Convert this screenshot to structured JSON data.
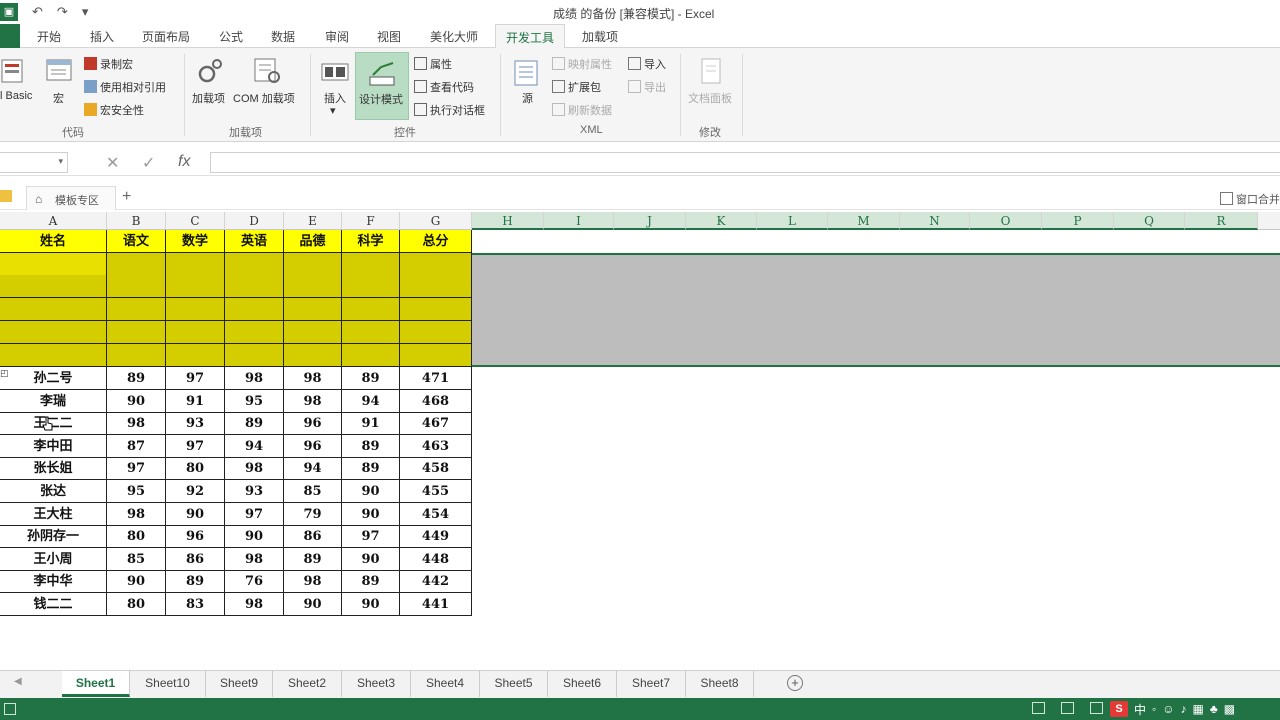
{
  "title": "成绩 的备份  [兼容模式] - Excel",
  "tabs": [
    "开始",
    "插入",
    "页面布局",
    "公式",
    "数据",
    "审阅",
    "视图",
    "美化大师",
    "开发工具",
    "加载项"
  ],
  "active_tab": "开发工具",
  "ribbon": {
    "code": {
      "vb": "l Basic",
      "macro": "宏",
      "record_macro": "录制宏",
      "relative_ref": "使用相对引用",
      "macro_security": "宏安全性",
      "label": "代码"
    },
    "addins": {
      "addins": "加载项",
      "com_addins": "COM 加载项",
      "label": "加载项"
    },
    "controls": {
      "insert": "插入",
      "design_mode": "设计模式",
      "properties": "属性",
      "view_code": "查看代码",
      "run_dialog": "执行对话框",
      "label": "控件"
    },
    "xml": {
      "source": "源",
      "map_props": "映射属性",
      "expansion": "扩展包",
      "refresh": "刷新数据",
      "import": "导入",
      "export": "导出",
      "label": "XML"
    },
    "modify": {
      "doc_panel": "文档面板",
      "label": "修改"
    }
  },
  "formula_bar": {
    "fx": "fx",
    "cancel": "✕",
    "confirm": "✓",
    "dropdown": "▾"
  },
  "doc_tab": {
    "label": "模板专区",
    "plus": "+",
    "window_merge": "窗口合并"
  },
  "columns": [
    "A",
    "B",
    "C",
    "D",
    "E",
    "F",
    "G",
    "H",
    "I",
    "J",
    "K",
    "L",
    "M",
    "N",
    "O",
    "P",
    "Q",
    "R"
  ],
  "header_row": [
    "姓名",
    "语文",
    "数学",
    "英语",
    "品德",
    "科学",
    "总分"
  ],
  "rows": [
    [
      "孙二号",
      "89",
      "97",
      "98",
      "98",
      "89",
      "471"
    ],
    [
      "李瑞",
      "90",
      "91",
      "95",
      "98",
      "94",
      "468"
    ],
    [
      "王二二",
      "98",
      "93",
      "89",
      "96",
      "91",
      "467"
    ],
    [
      "李中田",
      "87",
      "97",
      "94",
      "96",
      "89",
      "463"
    ],
    [
      "张长姐",
      "97",
      "80",
      "98",
      "94",
      "89",
      "458"
    ],
    [
      "张达",
      "95",
      "92",
      "93",
      "85",
      "90",
      "455"
    ],
    [
      "王大柱",
      "98",
      "90",
      "97",
      "79",
      "90",
      "454"
    ],
    [
      "孙阴存一",
      "80",
      "96",
      "90",
      "86",
      "97",
      "449"
    ],
    [
      "王小周",
      "85",
      "86",
      "98",
      "89",
      "90",
      "448"
    ],
    [
      "李中华",
      "90",
      "89",
      "76",
      "98",
      "89",
      "442"
    ],
    [
      "钱二二",
      "80",
      "83",
      "98",
      "90",
      "90",
      "441"
    ]
  ],
  "sheets": [
    "Sheet1",
    "Sheet10",
    "Sheet9",
    "Sheet2",
    "Sheet3",
    "Sheet4",
    "Sheet5",
    "Sheet6",
    "Sheet7",
    "Sheet8"
  ],
  "active_sheet": "Sheet1",
  "ime": {
    "logo": "S",
    "mode": "中"
  },
  "colors": {
    "accent": "#217346",
    "header_fill": "#ffff00",
    "highlight_fill": "#d4cd00",
    "selection_gray": "#bdbdbd"
  }
}
